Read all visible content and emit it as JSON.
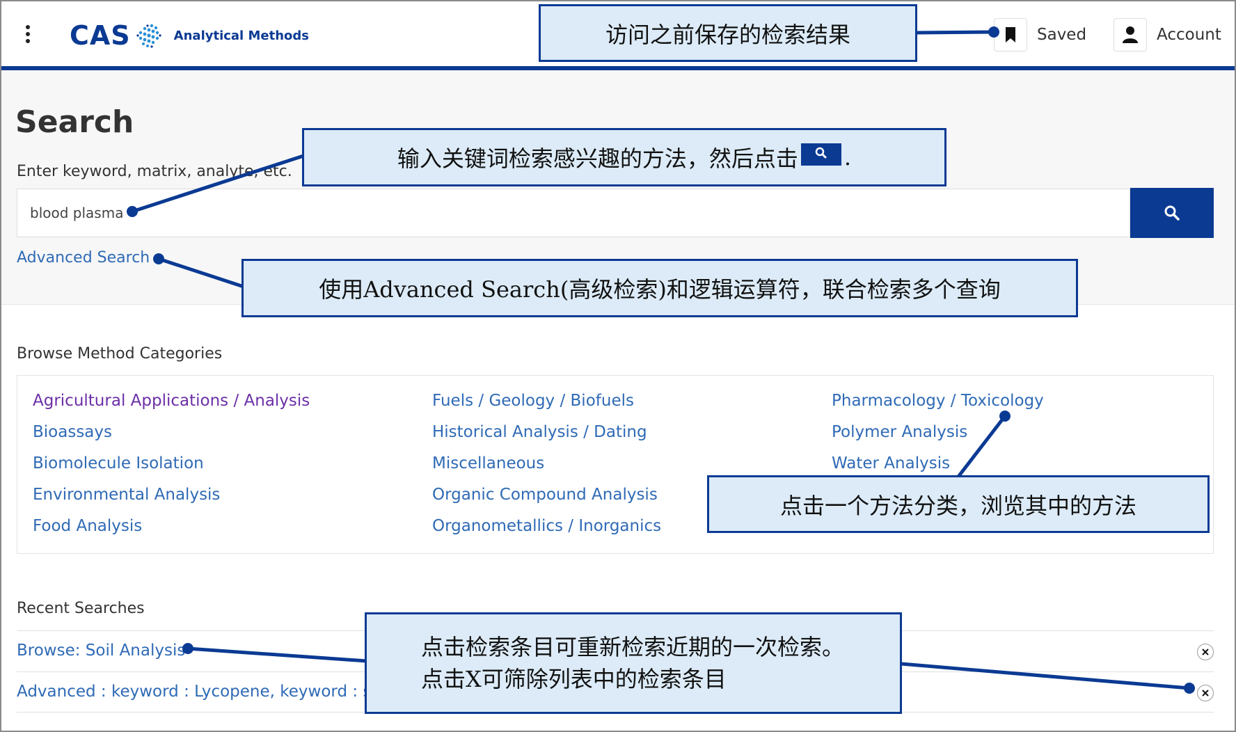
{
  "header": {
    "logo_text": "CAS",
    "logo_subtitle": "Analytical Methods",
    "saved_label": "Saved",
    "account_label": "Account"
  },
  "search": {
    "title": "Search",
    "label": "Enter keyword, matrix, analyte, etc.",
    "value": "blood plasma",
    "advanced_link": "Advanced Search"
  },
  "browse": {
    "title": "Browse Method Categories",
    "columns": [
      [
        "Agricultural Applications / Analysis",
        "Bioassays",
        "Biomolecule Isolation",
        "Environmental Analysis",
        "Food Analysis"
      ],
      [
        "Fuels / Geology / Biofuels",
        "Historical Analysis / Dating",
        "Miscellaneous",
        "Organic Compound Analysis",
        "Organometallics / Inorganics"
      ],
      [
        "Pharmacology / Toxicology",
        "Polymer Analysis",
        "Water Analysis"
      ]
    ]
  },
  "recent": {
    "title": "Recent Searches",
    "items": [
      "Browse: Soil Analysis",
      "Advanced : keyword : Lycopene, keyword : so"
    ]
  },
  "callouts": {
    "saved": "访问之前保存的检索结果",
    "search_before": "输入关键词检索感兴趣的方法，然后点击",
    "search_after": ".",
    "advanced": "使用Advanced Search(高级检索)和逻辑运算符，联合检索多个查询",
    "browse": "点击一个方法分类，浏览其中的方法",
    "recent_line1": "点击检索条目可重新检索近期的一次检索。",
    "recent_line2": "点击X可筛除列表中的检索条目"
  },
  "colors": {
    "brand": "#0b3a93",
    "link": "#2f6ab5",
    "visited": "#6b2fa6",
    "callout_bg": "#dcebf7"
  }
}
